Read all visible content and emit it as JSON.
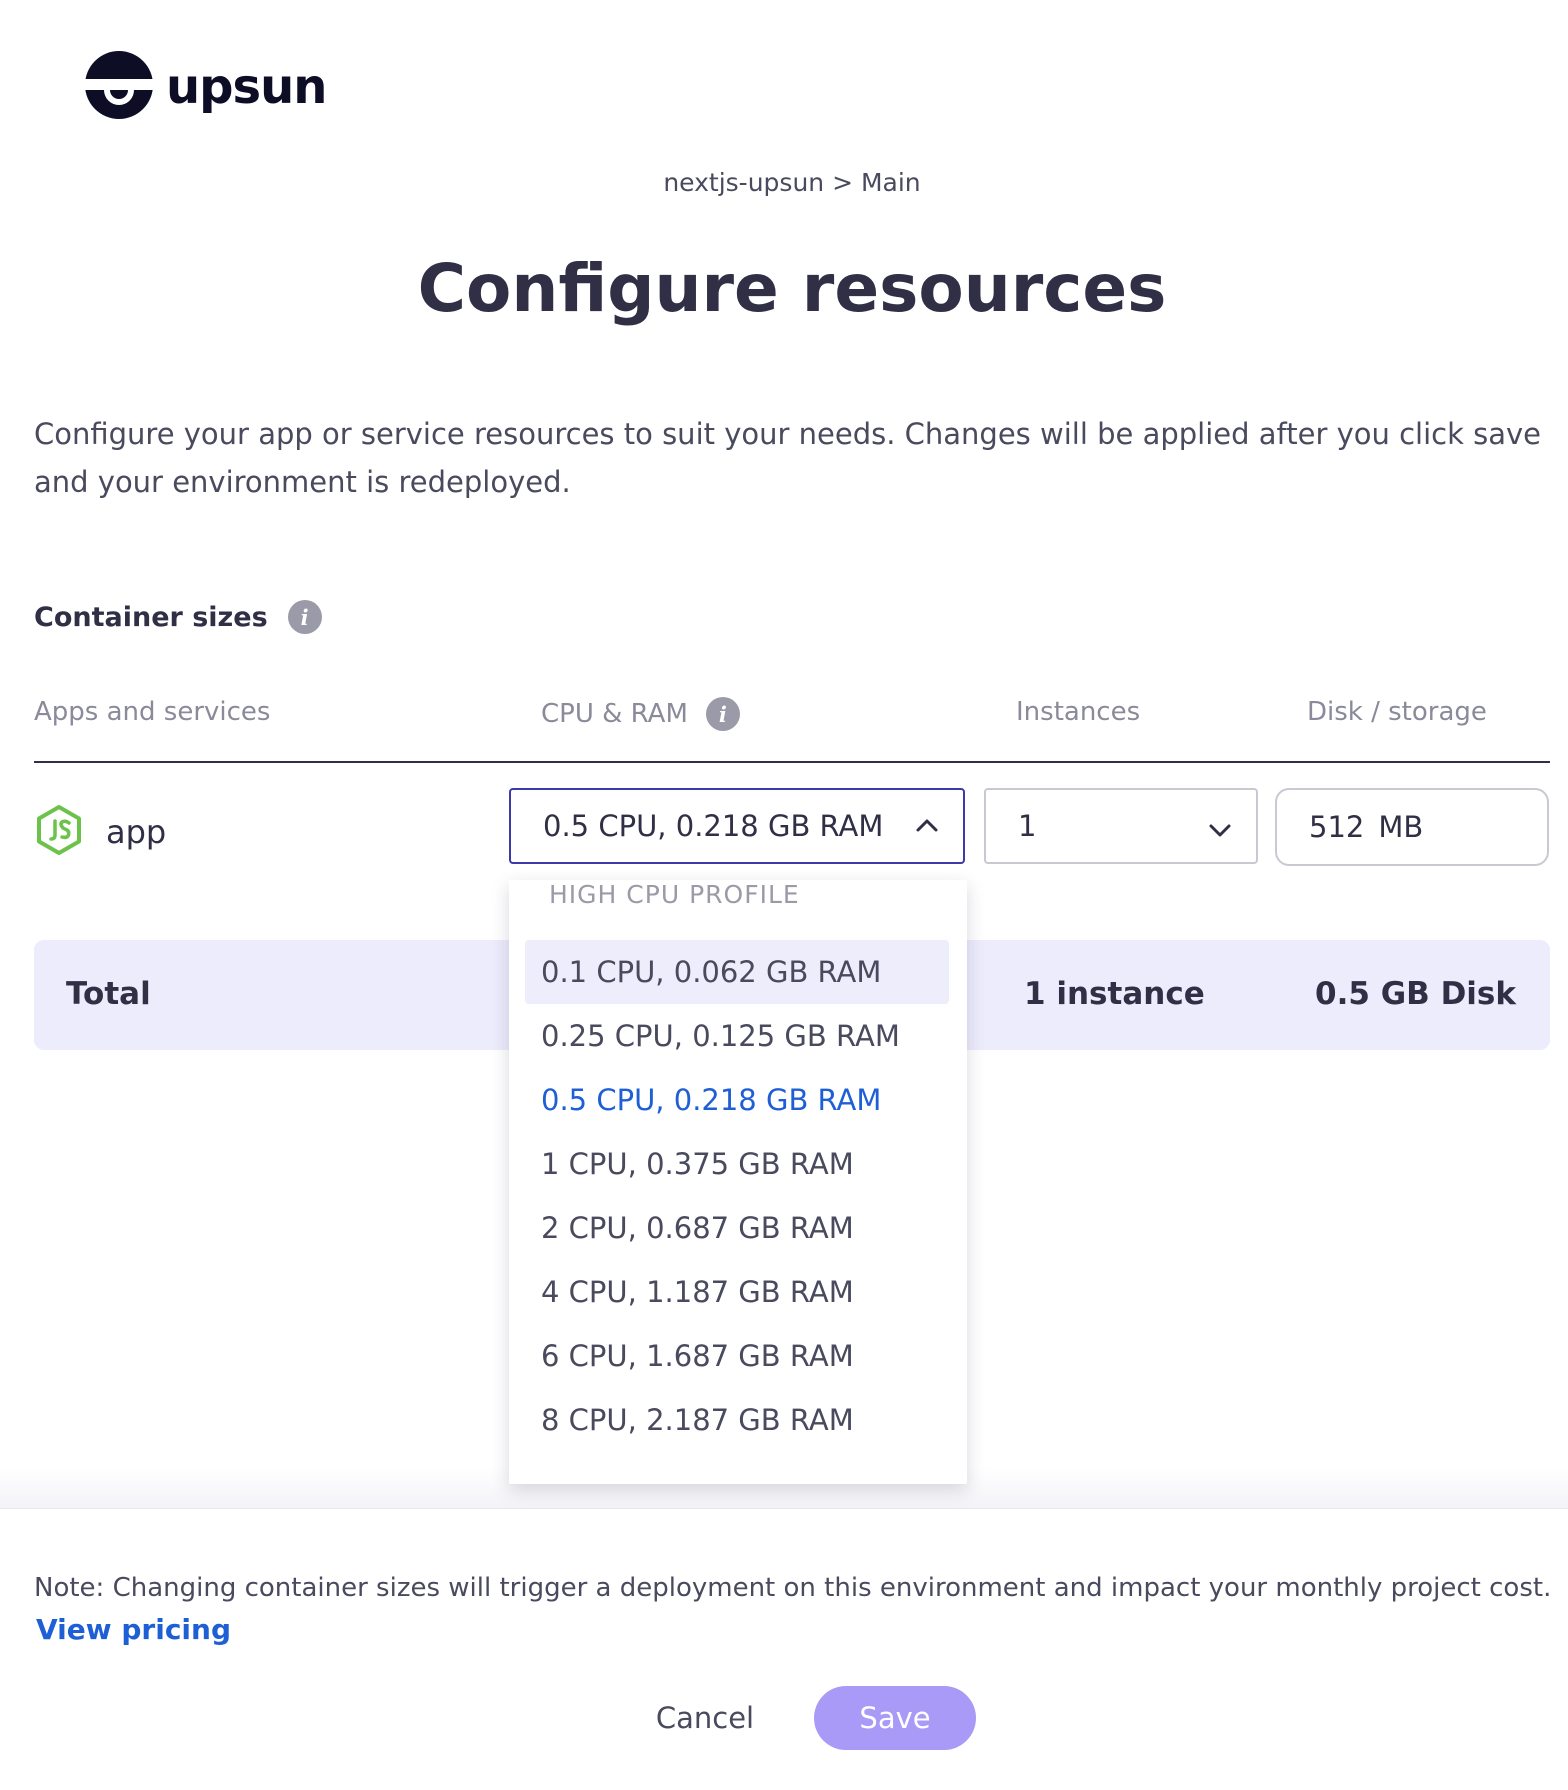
{
  "brand": {
    "name": "upsun"
  },
  "breadcrumb": {
    "text": "nextjs-upsun > Main"
  },
  "page": {
    "title": "Configure resources",
    "description": "Configure your app or service resources to suit your needs. Changes will be applied after you click save and your environment is redeployed."
  },
  "section": {
    "title": "Container sizes"
  },
  "columns": {
    "apps": "Apps and services",
    "cpu": "CPU & RAM",
    "instances": "Instances",
    "disk": "Disk / storage"
  },
  "row": {
    "app_name": "app",
    "cpu_value": "0.5 CPU, 0.218 GB RAM",
    "instances_value": "1",
    "disk_value": "512",
    "disk_unit": "MB"
  },
  "dropdown": {
    "group_label": "HIGH CPU PROFILE",
    "options": [
      "0.1 CPU, 0.062 GB RAM",
      "0.25 CPU, 0.125 GB RAM",
      "0.5 CPU, 0.218 GB RAM",
      "1 CPU, 0.375 GB RAM",
      "2 CPU, 0.687 GB RAM",
      "4 CPU, 1.187 GB RAM",
      "6 CPU, 1.687 GB RAM",
      "8 CPU, 2.187 GB RAM"
    ],
    "highlighted_index": 0,
    "selected_index": 2
  },
  "total": {
    "label": "Total",
    "instances": "1 instance",
    "disk": "0.5 GB Disk"
  },
  "footer": {
    "note": "Note: Changing container sizes will trigger a deployment on this environment and impact your monthly project cost.",
    "pricing_link": "View pricing",
    "cancel_label": "Cancel",
    "save_label": "Save"
  },
  "colors": {
    "primary_text": "#302f45",
    "accent_link": "#1f5fd6",
    "save_button": "#a99af7",
    "total_bar": "#ececfc",
    "select_focus": "#3b3aa8",
    "nodejs_green": "#6cc24a"
  },
  "icons": {
    "logo": "upsun-logo-icon",
    "info": "info-icon",
    "app": "nodejs-icon",
    "select_open": "chevron-up-icon",
    "select_closed": "chevron-down-icon"
  }
}
